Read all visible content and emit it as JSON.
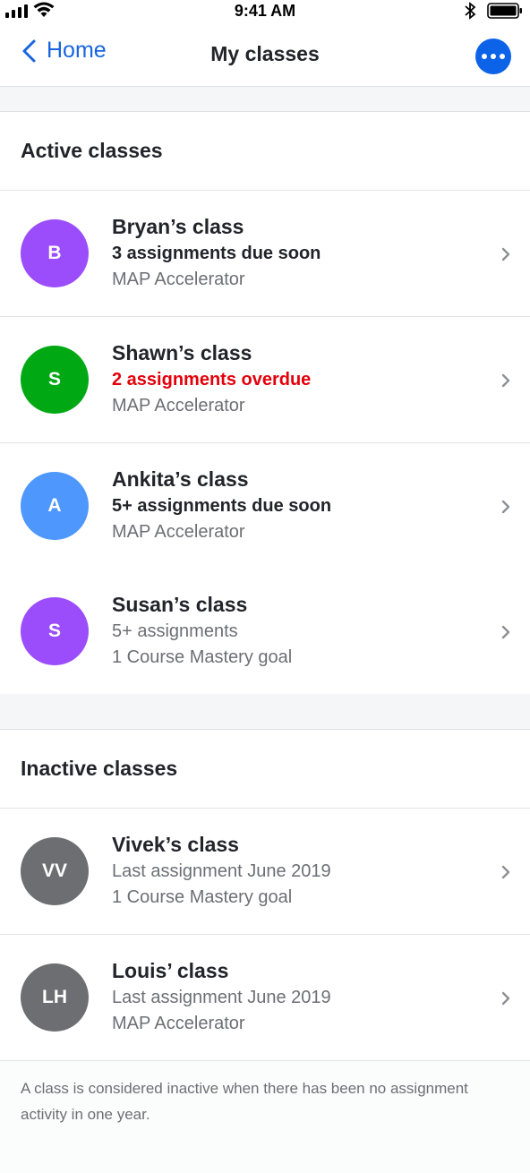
{
  "status_bar": {
    "time": "9:41 AM"
  },
  "nav": {
    "back_label": "Home",
    "title": "My classes"
  },
  "colors": {
    "accent": "#0d63e8",
    "overdue": "#e3000b",
    "purple": "#9b4dfc",
    "green": "#00a814",
    "blue": "#4e97fd",
    "gray": "#6d6e72"
  },
  "active": {
    "header": "Active classes",
    "rows": [
      {
        "initials": "B",
        "title": "Bryan’s class",
        "line1": "3 assignments due soon",
        "line2": "MAP Accelerator"
      },
      {
        "initials": "S",
        "title": "Shawn’s class",
        "line1": "2 assignments overdue",
        "line2": "MAP Accelerator"
      },
      {
        "initials": "A",
        "title": "Ankita’s class",
        "line1": "5+ assignments due soon",
        "line2": "MAP Accelerator"
      },
      {
        "initials": "S",
        "title": "Susan’s class",
        "line1": "5+ assignments",
        "line2": "1 Course Mastery goal"
      }
    ]
  },
  "inactive": {
    "header": "Inactive classes",
    "rows": [
      {
        "initials": "VV",
        "title": "Vivek’s class",
        "line1": "Last assignment June 2019",
        "line2": "1 Course Mastery goal"
      },
      {
        "initials": "LH",
        "title": "Louis’ class",
        "line1": "Last assignment June 2019",
        "line2": "MAP Accelerator"
      }
    ]
  },
  "footer_note": "A class is considered inactive when there has been no assignment activity in one year."
}
